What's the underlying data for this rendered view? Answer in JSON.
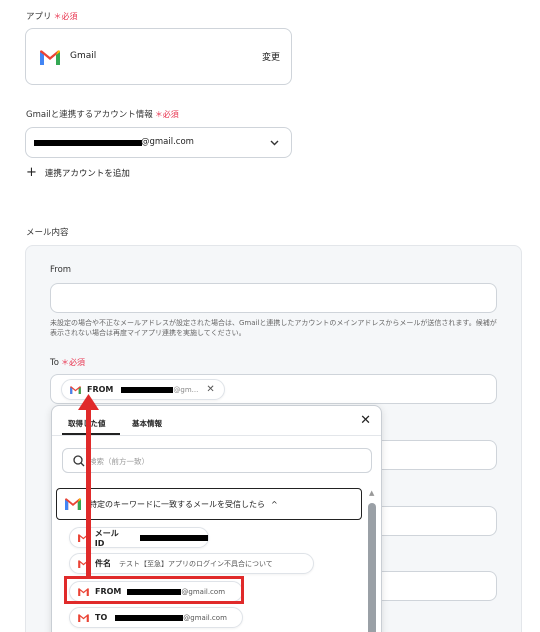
{
  "app_section": {
    "label": "アプリ",
    "required": "＊必須",
    "app_name": "Gmail",
    "change_label": "変更"
  },
  "account_section": {
    "label": "Gmailと連携するアカウント情報",
    "required": "＊必須",
    "email_suffix": "@gmail.com",
    "add_account_label": "連携アカウントを追加"
  },
  "mail_content": {
    "label": "メール内容",
    "from_label": "From",
    "from_hint": "未設定の場合や不正なメールアドレスが設定された場合は、Gmailと連携したアカウントのメインアドレスからメールが送信されます。候補が表示されない場合は再度マイアプリ連携を実施してください。",
    "to_label": "To",
    "to_required": "＊必須",
    "to_chip_label": "FROM",
    "to_chip_suffix": "@gm..."
  },
  "popup": {
    "tabs": [
      "取得した値",
      "基本情報"
    ],
    "search_placeholder": "検索（前方一致）",
    "trigger_label": "特定のキーワードに一致するメールを受信したら",
    "items": [
      {
        "label": "メールID",
        "value": ""
      },
      {
        "label": "件名",
        "value": "テスト【至急】アプリのログイン不具合について"
      },
      {
        "label": "FROM",
        "value": "@gmail.com"
      },
      {
        "label": "TO",
        "value": "@gmail.com"
      }
    ]
  },
  "colors": {
    "accent_red": "#e02a2a",
    "required_red": "#e8334e",
    "panel_bg": "#f5f7f9"
  }
}
